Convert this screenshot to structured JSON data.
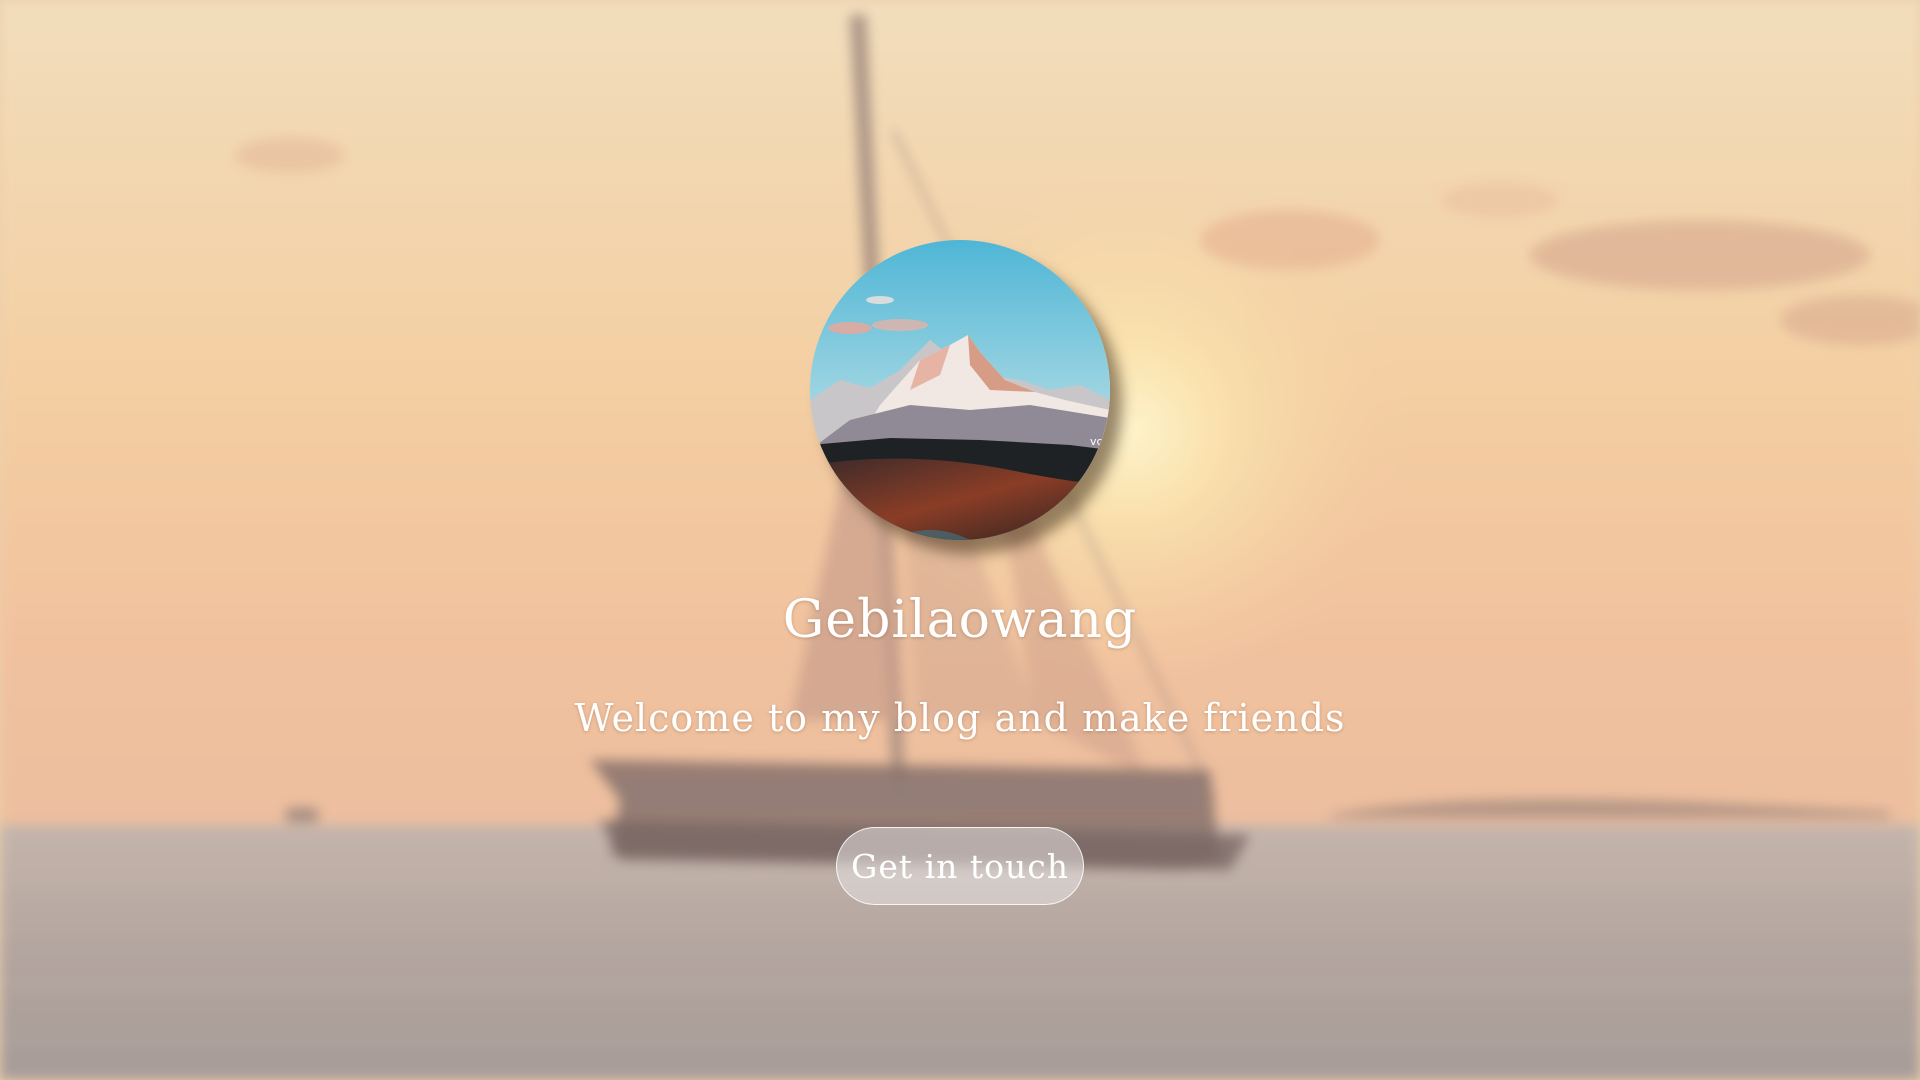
{
  "hero": {
    "background_description_color": "#f0c896",
    "avatar_icon": "mountain-landscape-avatar",
    "avatar_watermark": "vc",
    "title": "Gebilaowang",
    "tagline": "Welcome to my blog and make friends",
    "cta_label": "Get in touch"
  },
  "colors": {
    "text": "#ffffff",
    "sky": "#ecd2a8",
    "sea": "#9a8d8a",
    "button_fill": "#e6e1e1"
  }
}
